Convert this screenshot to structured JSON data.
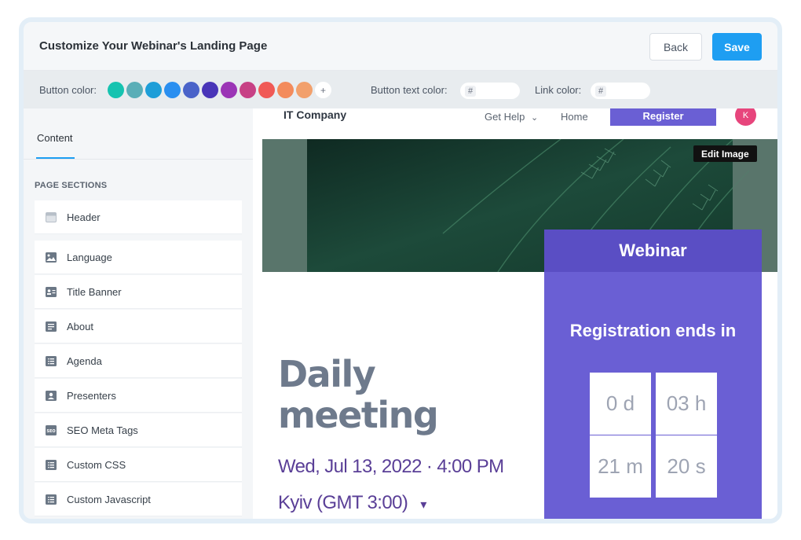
{
  "header": {
    "title": "Customize Your Webinar's Landing Page",
    "back_label": "Back",
    "save_label": "Save"
  },
  "colorbar": {
    "button_color_label": "Button color:",
    "swatches": [
      "#16c3b0",
      "#5aaeb7",
      "#1e9ed8",
      "#2a8ff0",
      "#4a63c9",
      "#4935b8",
      "#9b35b6",
      "#c74185",
      "#f05a56",
      "#f38b5c",
      "#f2a06c"
    ],
    "add_label": "+",
    "button_text_color_label": "Button text color:",
    "link_color_label": "Link color:",
    "hash_symbol": "#"
  },
  "sidebar": {
    "tab_label": "Content",
    "section_heading": "PAGE SECTIONS",
    "items": [
      {
        "label": "Header",
        "icon": "header-icon"
      },
      {
        "label": "Language",
        "icon": "image-icon"
      },
      {
        "label": "Title Banner",
        "icon": "id-card-icon"
      },
      {
        "label": "About",
        "icon": "document-icon"
      },
      {
        "label": "Agenda",
        "icon": "list-icon"
      },
      {
        "label": "Presenters",
        "icon": "person-icon"
      },
      {
        "label": "SEO Meta Tags",
        "icon": "seo-icon"
      },
      {
        "label": "Custom CSS",
        "icon": "list-icon"
      },
      {
        "label": "Custom Javascript",
        "icon": "list-icon"
      }
    ]
  },
  "preview": {
    "nav": {
      "company": "IT Company",
      "get_help": "Get Help",
      "chevron": "⌄",
      "home": "Home",
      "register": "Register",
      "avatar_initial": "K"
    },
    "edit_image_label": "Edit Image",
    "event": {
      "title_line1": "Daily",
      "title_line2": "meeting",
      "date": "Wed, Jul 13, 2022 · 4:00 PM",
      "timezone": "Kyiv (GMT 3:00)",
      "tz_caret": "▾"
    },
    "panel": {
      "heading": "Webinar",
      "registration_ends": "Registration ends in",
      "countdown": {
        "days": "0 d",
        "hours": "03 h",
        "minutes": "21 m",
        "seconds": "20 s"
      }
    }
  }
}
